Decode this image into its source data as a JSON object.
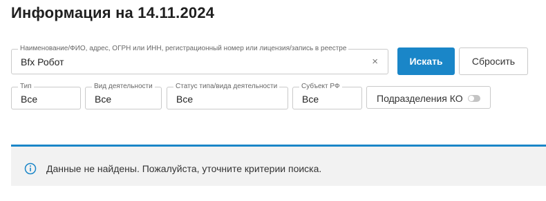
{
  "header": {
    "title": "Информация на 14.11.2024"
  },
  "search": {
    "legend": "Наименование/ФИО, адрес, ОГРН или ИНН, регистрационный номер или лицензия/запись в реестре",
    "value": "Bfx Робот",
    "clear_icon": "close-icon",
    "search_label": "Искать",
    "reset_label": "Сбросить"
  },
  "filters": [
    {
      "legend": "Тип",
      "value": "Все"
    },
    {
      "legend": "Вид деятельности",
      "value": "Все"
    },
    {
      "legend": "Статус типа/вида деятельности",
      "value": "Все"
    },
    {
      "legend": "Субъект РФ",
      "value": "Все"
    }
  ],
  "ko_toggle": {
    "label": "Подразделения КО",
    "on": false
  },
  "notice": {
    "icon": "info-icon",
    "text": "Данные не найдены. Пожалуйста, уточните критерии поиска."
  },
  "colors": {
    "accent": "#1a86c8",
    "notice_bg": "#f2f2f2",
    "border": "#c9c9c9"
  }
}
